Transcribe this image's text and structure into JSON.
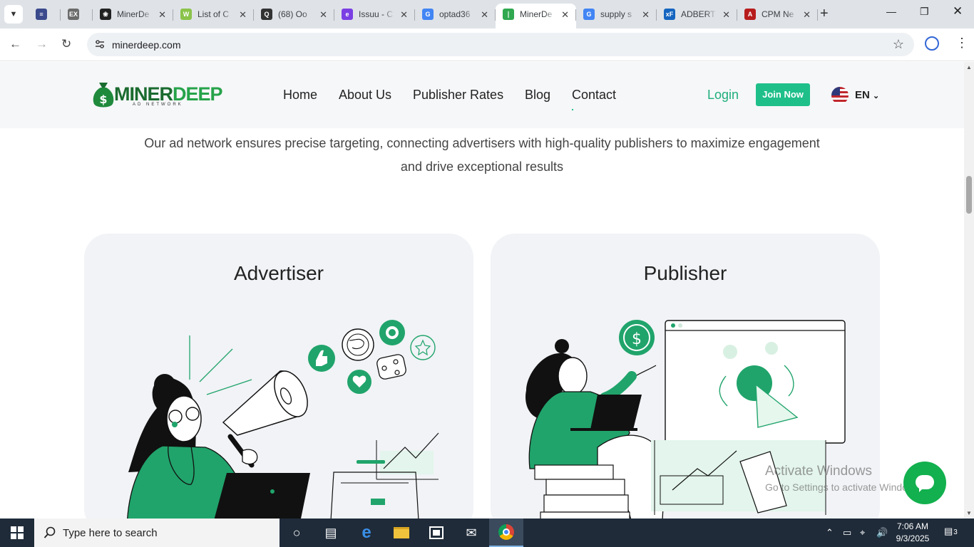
{
  "browser": {
    "tabs": [
      {
        "title": "",
        "icon": "stack-icon",
        "color": "#3b4a8c"
      },
      {
        "title": "",
        "icon": "exch-icon",
        "color": "#6b6b6b"
      },
      {
        "title": "MinerDe",
        "icon": "openai-icon",
        "color": "#222222"
      },
      {
        "title": "List of C",
        "icon": "w-icon",
        "color": "#8bc34a"
      },
      {
        "title": "(68) Oo",
        "icon": "quora-icon",
        "color": "#333333"
      },
      {
        "title": "Issuu - C",
        "icon": "issuu-icon",
        "color": "#7b3fe4"
      },
      {
        "title": "optad36",
        "icon": "google-icon",
        "color": "#4285f4"
      },
      {
        "title": "MinerDe",
        "icon": "minerdeep-icon",
        "color": "#2fa84f",
        "active": true
      },
      {
        "title": "supply s",
        "icon": "google-icon",
        "color": "#4285f4"
      },
      {
        "title": "ADBERT",
        "icon": "xf-icon",
        "color": "#1565c0"
      },
      {
        "title": "CPM Ne",
        "icon": "acrobat-icon",
        "color": "#b71c1c"
      }
    ],
    "url": "minerdeep.com"
  },
  "site": {
    "logo_word_a": "MINER",
    "logo_word_b": "DEEP",
    "logo_tagline": "AD NETWORK",
    "nav": [
      "Home",
      "About Us",
      "Publisher Rates",
      "Blog",
      "Contact"
    ],
    "login": "Login",
    "join": "Join Now",
    "language": "EN",
    "intro": "Our ad network ensures precise targeting, connecting advertisers with high-quality publishers to maximize engagement and drive exceptional results",
    "cards": [
      {
        "title": "Advertiser"
      },
      {
        "title": "Publisher"
      }
    ],
    "accent": "#1fbf8a",
    "illustration_green": "#20a46b"
  },
  "watermark": {
    "line1": "Activate Windows",
    "line2": "Go to Settings to activate Windows."
  },
  "taskbar": {
    "search_placeholder": "Type here to search",
    "time": "7:06 AM",
    "date": "9/3/2025",
    "notification_count": "3"
  }
}
